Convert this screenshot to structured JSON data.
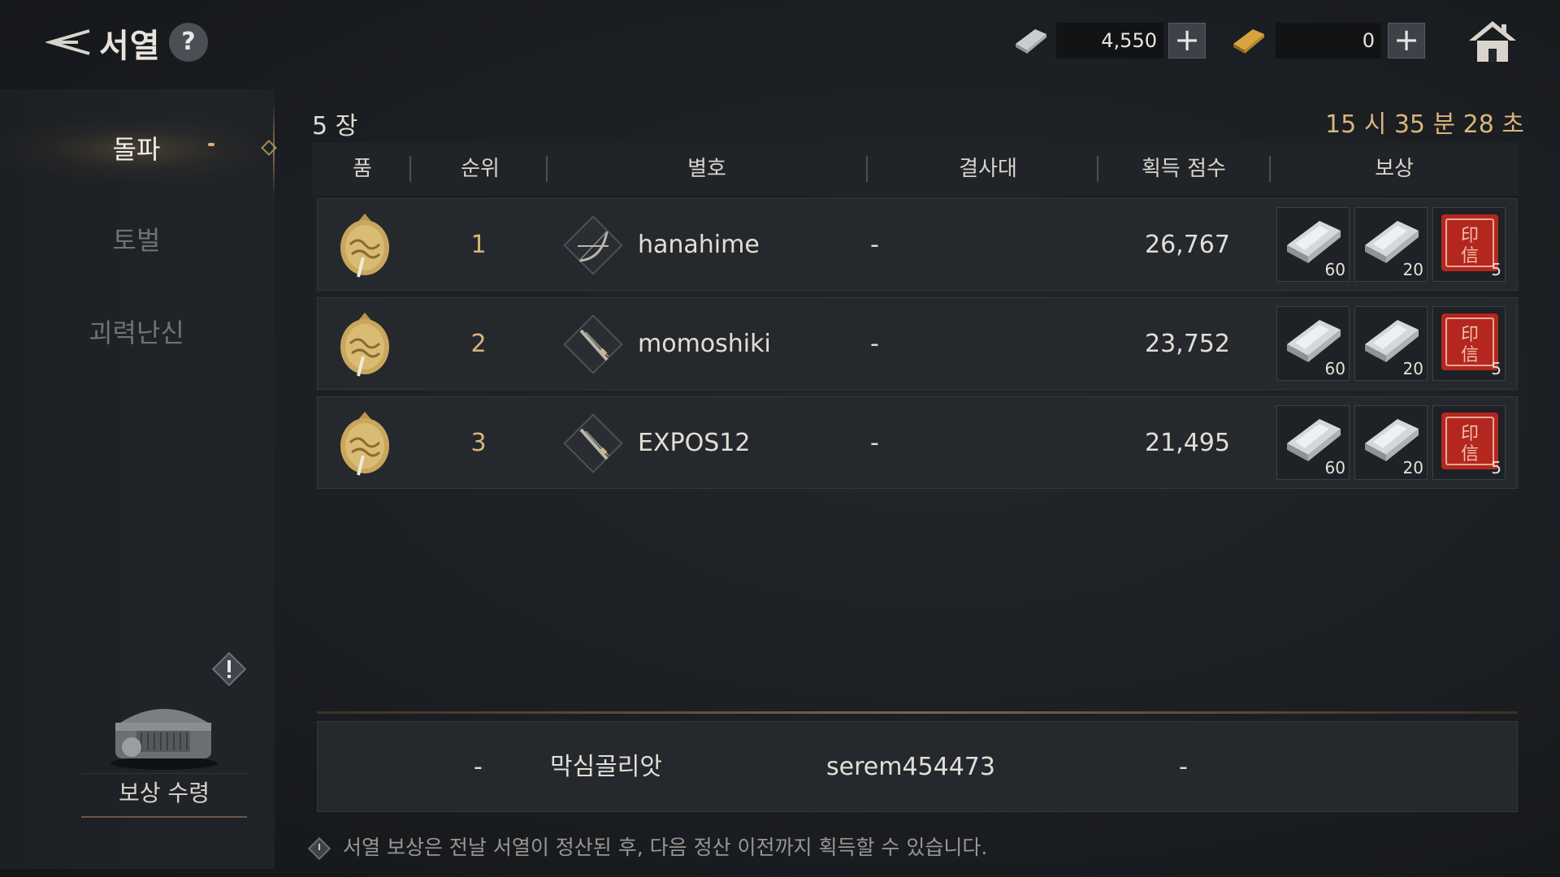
{
  "header": {
    "title": "서열",
    "help_label": "?",
    "currencies": [
      {
        "icon": "silver-ingot-icon",
        "value": "4,550",
        "add_label": "+"
      },
      {
        "icon": "gold-ingot-icon",
        "value": "0",
        "add_label": "+"
      }
    ]
  },
  "sidebar": {
    "tabs": [
      {
        "label": "돌파",
        "active": true
      },
      {
        "label": "토벌",
        "active": false
      },
      {
        "label": "괴력난신",
        "active": false
      }
    ],
    "reward_claim_label": "보상 수령",
    "alert_label": "!"
  },
  "main": {
    "count_label": "5 장",
    "timer": "15 시 35 분 28 초",
    "columns": [
      "품",
      "순위",
      "별호",
      "결사대",
      "획득 점수",
      "보상"
    ],
    "rows": [
      {
        "rank": "1",
        "class_icon": "bow-class-icon",
        "name": "hanahime",
        "guild": "-",
        "score": "26,767",
        "rewards": [
          {
            "icon": "silver-ingot-icon",
            "qty": "60"
          },
          {
            "icon": "silver-ingot-icon",
            "qty": "20"
          },
          {
            "icon": "red-seal-icon",
            "qty": "5"
          }
        ]
      },
      {
        "rank": "2",
        "class_icon": "blade-class-icon",
        "name": "momoshiki",
        "guild": "-",
        "score": "23,752",
        "rewards": [
          {
            "icon": "silver-ingot-icon",
            "qty": "60"
          },
          {
            "icon": "silver-ingot-icon",
            "qty": "20"
          },
          {
            "icon": "red-seal-icon",
            "qty": "5"
          }
        ]
      },
      {
        "rank": "3",
        "class_icon": "blade-class-icon",
        "name": "EXPOS12",
        "guild": "-",
        "score": "21,495",
        "rewards": [
          {
            "icon": "silver-ingot-icon",
            "qty": "60"
          },
          {
            "icon": "silver-ingot-icon",
            "qty": "20"
          },
          {
            "icon": "red-seal-icon",
            "qty": "5"
          }
        ]
      }
    ],
    "my_row": {
      "rank": "-",
      "name": "막심골리앗",
      "guild": "serem454473",
      "score": "-"
    },
    "footer_note": "서열 보상은 전날 서열이 정산된 후, 다음 정산 이전까지 획득할 수 있습니다."
  },
  "colors": {
    "accent_gold": "#d9b57a",
    "panel": "#25292d",
    "seal_red": "#b3271e"
  }
}
